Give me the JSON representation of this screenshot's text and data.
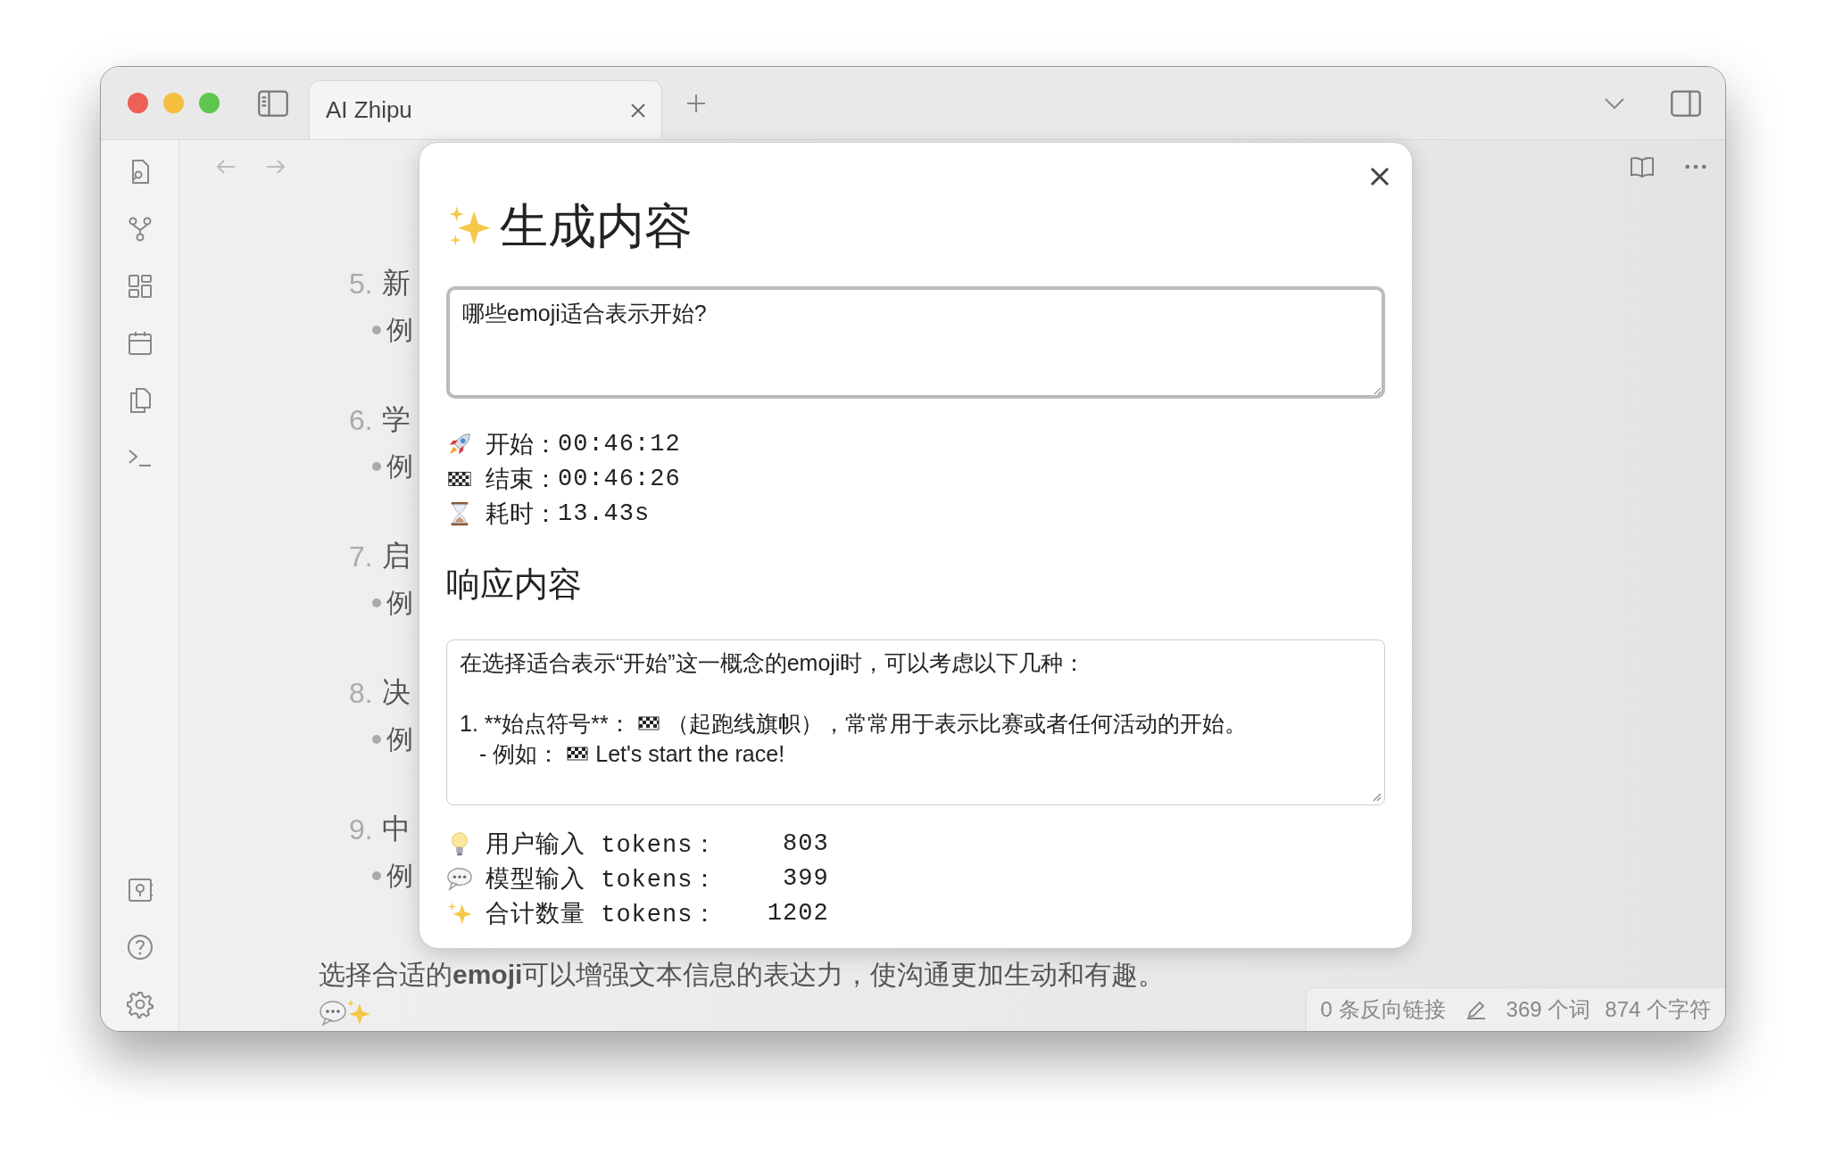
{
  "window": {
    "tab": {
      "title": "AI Zhipu",
      "selected": true
    }
  },
  "note": {
    "items": [
      {
        "number": "5.",
        "heading": "新",
        "bullet": "例"
      },
      {
        "number": "6.",
        "heading": "学",
        "bullet": "例"
      },
      {
        "number": "7.",
        "heading": "启",
        "bullet": "例"
      },
      {
        "number": "8.",
        "heading": "决",
        "bullet": "例"
      },
      {
        "number": "9.",
        "heading": "中",
        "bullet": "例"
      }
    ],
    "closing": "选择合适的**emoji**可以增强文本信息的表达力，使沟通更加生动和有趣。"
  },
  "status_bar": {
    "backlinks": "0 条反向链接",
    "words": "369 个词",
    "chars": "874 个字符"
  },
  "dialog": {
    "title": "生成内容",
    "prompt": {
      "value": "哪些emoji适合表示开始?"
    },
    "timing": [
      {
        "kind": "start",
        "label": "开始：",
        "value": "00:46:12"
      },
      {
        "kind": "end",
        "label": "结束：",
        "value": "00:46:26"
      },
      {
        "kind": "duration",
        "label": "耗时：",
        "value": "13.43s"
      }
    ],
    "response_heading": "响应内容",
    "response": {
      "intro": "在选择适合表示“开始”这一概念的emoji时，可以考虑以下几种：",
      "items": [
        {
          "parts": [
            "1. **始点符号**：",
            "（起跑线旗帜），常常用于表示比赛或者任何活动的开始。"
          ],
          "children": [
            {
              "parts": [
                "- 例如：",
                "Let's start the race!"
              ]
            }
          ]
        }
      ]
    },
    "tokens": [
      {
        "kind": "user",
        "label": "用户输入 tokens：",
        "value": "803"
      },
      {
        "kind": "model",
        "label": "模型输入 tokens：",
        "value": "399"
      },
      {
        "kind": "total",
        "label": "合计数量 tokens：",
        "value": "1202"
      }
    ]
  }
}
